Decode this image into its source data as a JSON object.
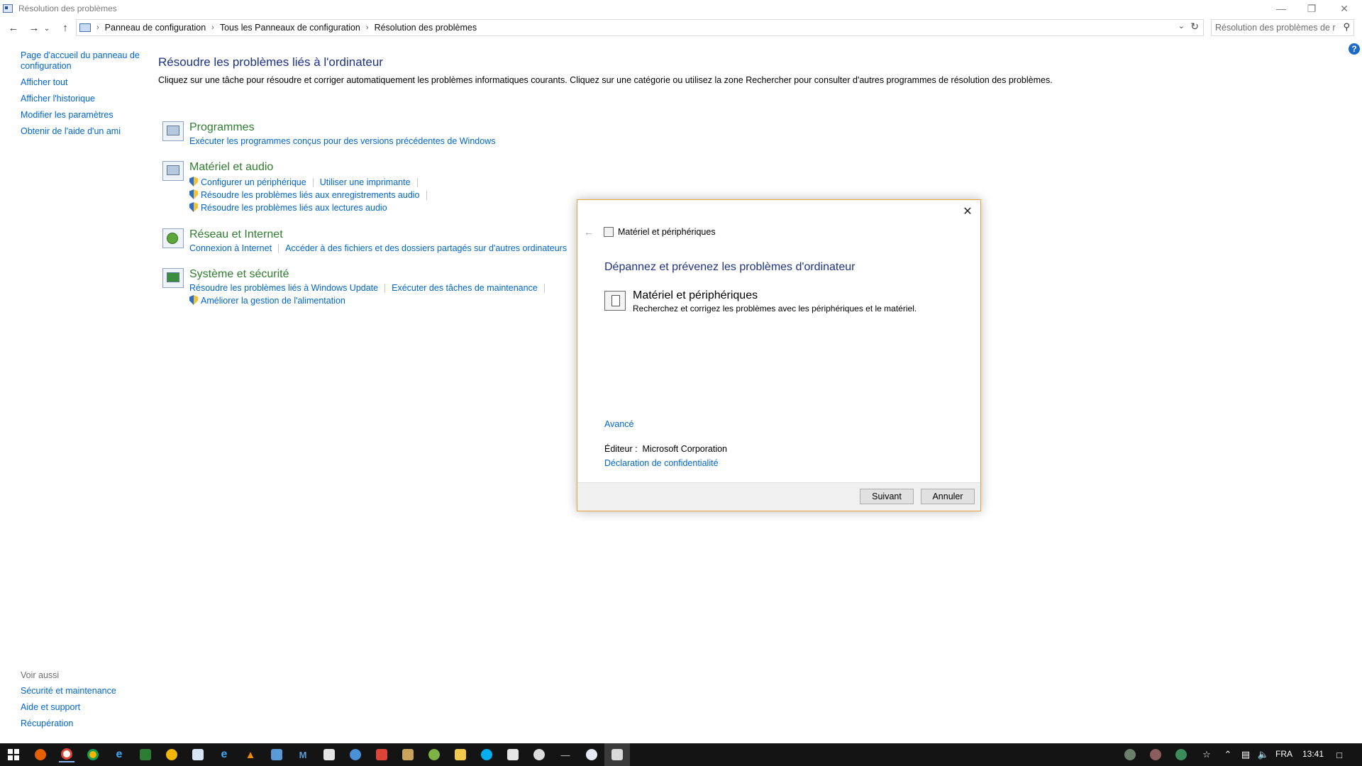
{
  "window": {
    "title": "Résolution des problèmes"
  },
  "address": {
    "crumbs": [
      "Panneau de configuration",
      "Tous les Panneaux de configuration",
      "Résolution des problèmes"
    ],
    "search_placeholder": "Résolution des problèmes de r..."
  },
  "sidebar": {
    "home_line1": "Page d'accueil du panneau de",
    "home_line2": "configuration",
    "items": [
      "Afficher tout",
      "Afficher l'historique",
      "Modifier les paramètres",
      "Obtenir de l'aide d'un ami"
    ],
    "see_also_header": "Voir aussi",
    "see_also": [
      "Sécurité et maintenance",
      "Aide et support",
      "Récupération"
    ]
  },
  "main": {
    "title": "Résoudre les problèmes liés à l'ordinateur",
    "intro": "Cliquez sur une tâche pour résoudre et corriger automatiquement les problèmes informatiques courants. Cliquez sur une catégorie ou utilisez la zone Rechercher pour consulter d'autres programmes de résolution des problèmes.",
    "categories": [
      {
        "title": "Programmes",
        "links": [
          "Exécuter les programmes conçus pour des versions précédentes de Windows"
        ]
      },
      {
        "title": "Matériel et audio",
        "links": [
          "Configurer un périphérique",
          "Utiliser une imprimante",
          "Résoudre les problèmes liés aux enregistrements audio",
          "Résoudre les problèmes liés aux lectures audio"
        ]
      },
      {
        "title": "Réseau et Internet",
        "links": [
          "Connexion à Internet",
          "Accéder à des fichiers et des dossiers partagés sur d'autres ordinateurs"
        ]
      },
      {
        "title": "Système et sécurité",
        "links": [
          "Résoudre les problèmes liés à Windows Update",
          "Exécuter des tâches de maintenance",
          "Améliorer la gestion de l'alimentation"
        ]
      }
    ]
  },
  "dialog": {
    "header_title": "Matériel et périphériques",
    "heading": "Dépannez et prévenez les problèmes d'ordinateur",
    "option_title": "Matériel et périphériques",
    "option_desc": "Recherchez et corrigez les problèmes avec les périphériques et le matériel.",
    "advanced": "Avancé",
    "publisher_label": "Éditeur :",
    "publisher_value": "Microsoft Corporation",
    "privacy": "Déclaration de confidentialité",
    "next_button": "Suivant",
    "cancel_button": "Annuler"
  },
  "taskbar": {
    "language": "FRA",
    "time": "13:41"
  },
  "colors": {
    "link": "#0066cc",
    "title_blue": "#1e3287",
    "category_green": "#2f7d2f",
    "dialog_border": "#e8a23c",
    "taskbar": "#141414"
  }
}
